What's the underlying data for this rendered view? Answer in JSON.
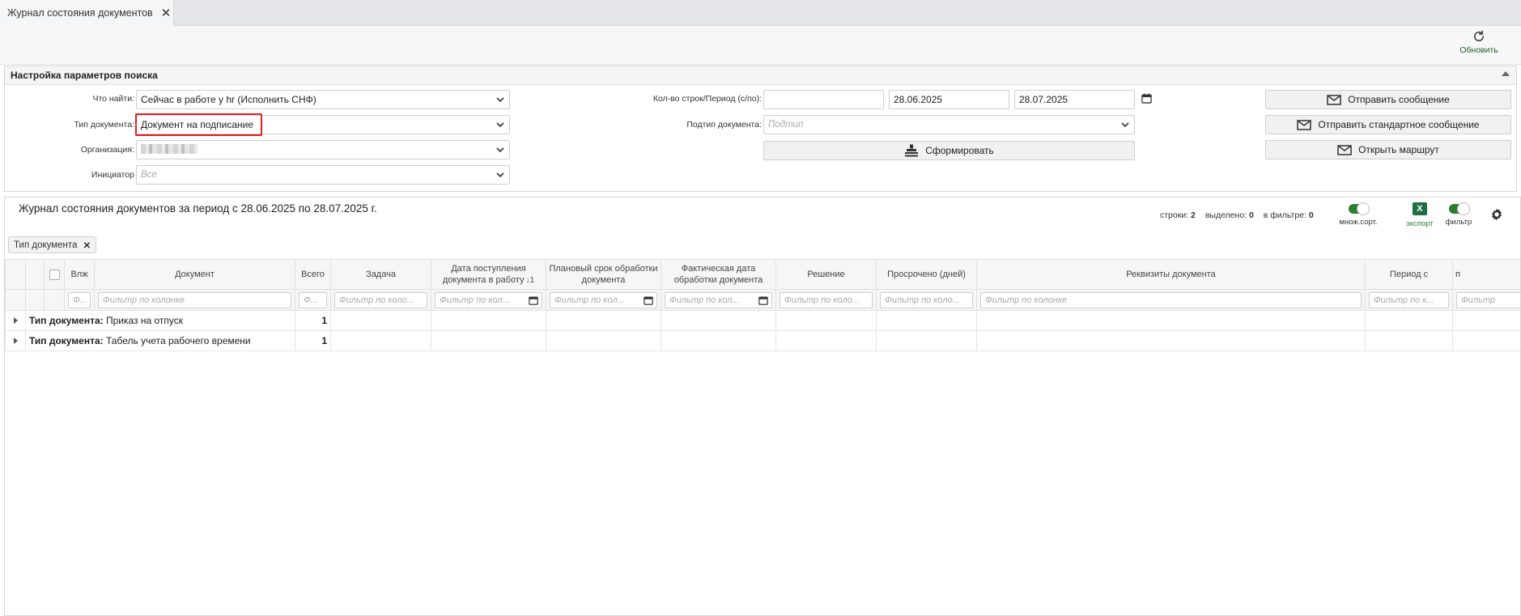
{
  "tab": {
    "title": "Журнал состояния документов"
  },
  "toolbar": {
    "refresh_label": "Обновить"
  },
  "search_panel": {
    "title": "Настройка параметров поиска",
    "what_label": "Что найти:",
    "what_value": "Сейчас в работе у hr (Исполнить СНФ)",
    "doctype_label": "Тип документа:",
    "doctype_value": "Документ на подписание",
    "org_label": "Организация:",
    "initiator_label": "Инициатор",
    "initiator_placeholder": "Все",
    "rows_period_label": "Кол-во строк/Период (с/по):",
    "rows_value": "",
    "date_from": "28.06.2025",
    "date_to": "28.07.2025",
    "subtype_label": "Подтип документа:",
    "subtype_placeholder": "Подтип",
    "form_button": "Сформировать",
    "send_message_button": "Отправить сообщение",
    "send_std_message_button": "Отправить стандартное сообщение",
    "open_route_button": "Открыть маршрут"
  },
  "grid": {
    "title": "Журнал состояния документов за период с 28.06.2025 по 28.07.2025 г.",
    "stats": {
      "rows_label": "строки:",
      "rows_value": "2",
      "selected_label": "выделено:",
      "selected_value": "0",
      "filtered_label": "в фильтре:",
      "filtered_value": "0"
    },
    "multisort_label": "множ.сорт.",
    "export_label": "экспорт",
    "export_icon_text": "X",
    "filter_label": "фильтр",
    "group_chip": "Тип документа",
    "columns": {
      "vlzh": "Влж",
      "document": "Документ",
      "total": "Всего",
      "task": "Задача",
      "date_received": "Дата поступления документа в работу",
      "sort_indicator": "↓1",
      "planned": "Плановый срок обработки документа",
      "actual": "Фактическая дата обработки документа",
      "decision": "Решение",
      "overdue": "Просрочено (дней)",
      "requisites": "Реквизиты документа",
      "period_from": "Период с",
      "period_to": "п"
    },
    "filter_placeholders": {
      "short": "Ф...",
      "full": "Фильтр по колонке",
      "trunc": "Фильтр по коло...",
      "date": "Фильтр по кол...",
      "k": "Фильтр по к...",
      "cut": "Фильтр"
    },
    "rows": [
      {
        "group_label": "Тип документа:",
        "group_value": "Приказ на отпуск",
        "total": "1"
      },
      {
        "group_label": "Тип документа:",
        "group_value": "Табель учета рабочего времени",
        "total": "1"
      }
    ]
  },
  "colors": {
    "accent_green": "#2e7d32",
    "highlight_red": "#e0201b"
  }
}
